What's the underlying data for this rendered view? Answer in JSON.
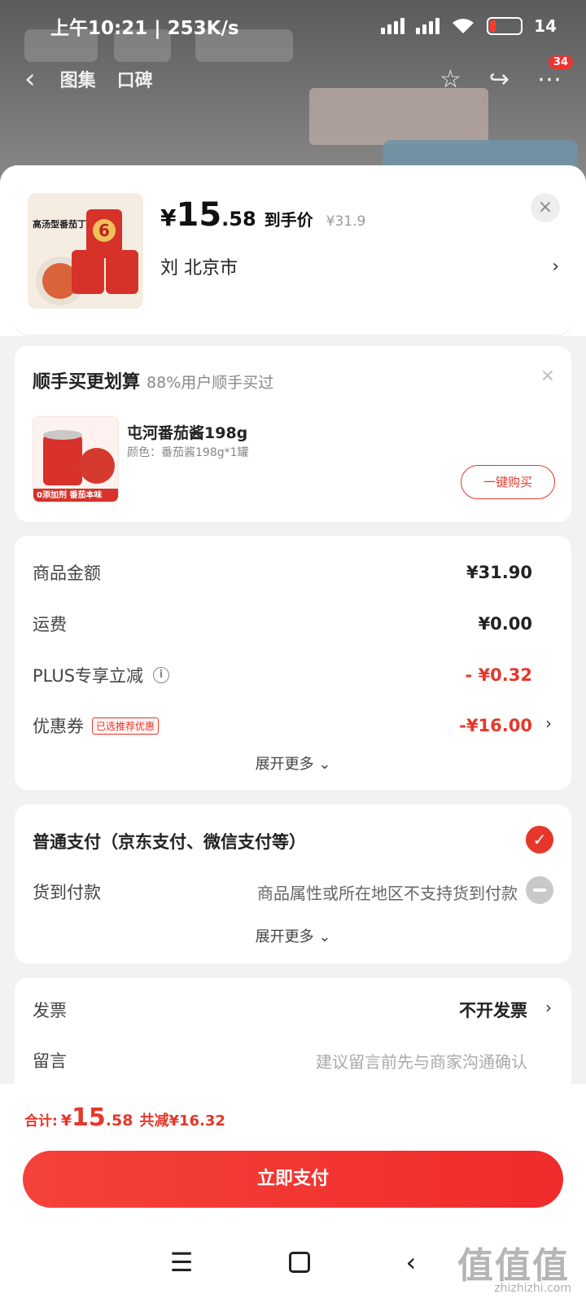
{
  "status_bar": {
    "time": "上午10:21 | 253K/s",
    "battery": "14"
  },
  "background_nav": {
    "tabs": [
      "图集",
      "口碑"
    ],
    "cart_badge": "34"
  },
  "product": {
    "yen_symbol": "¥",
    "price_int": "15",
    "price_dec": ".58",
    "price_tag": "到手价",
    "original_price": "¥31.9",
    "address": "刘  北京市",
    "thumb_text": "高汤型番茄丁",
    "thumb_number": "6"
  },
  "addon": {
    "title": "顺手买更划算",
    "subtitle": "88%用户顺手买过",
    "item_name": "屯河番茄酱198g",
    "item_spec": "颜色：番茄酱198g*1罐",
    "img_caption": "0添加剂  番茄本味",
    "buy_button": "一键购买"
  },
  "summary": {
    "rows": [
      {
        "label": "商品金额",
        "value": "¥31.90"
      },
      {
        "label": "运费",
        "value": "¥0.00"
      },
      {
        "label": "PLUS专享立减",
        "value": "- ¥0.32"
      },
      {
        "label": "优惠券",
        "value": "-¥16.00"
      }
    ],
    "coupon_tag": "已选推荐优惠",
    "expand": "展开更多 ⌄"
  },
  "payment": {
    "normal": "普通支付（京东支付、微信支付等）",
    "cod_label": "货到付款",
    "cod_note": "商品属性或所在地区不支持货到付款",
    "expand": "展开更多 ⌄"
  },
  "extras": {
    "invoice_label": "发票",
    "invoice_value": "不开发票",
    "message_label": "留言",
    "message_placeholder": "建议留言前先与商家沟通确认"
  },
  "footer": {
    "total_label": "合计:",
    "total_yen": "¥",
    "total_int": "15",
    "total_dec": ".58",
    "total_save": "共减¥16.32",
    "pay_button": "立即支付"
  },
  "watermark": {
    "text": "值值值",
    "url": "zhizhizhi.com"
  },
  "colors": {
    "accent": "#e5372b",
    "pay_button": "#f02b2b"
  }
}
